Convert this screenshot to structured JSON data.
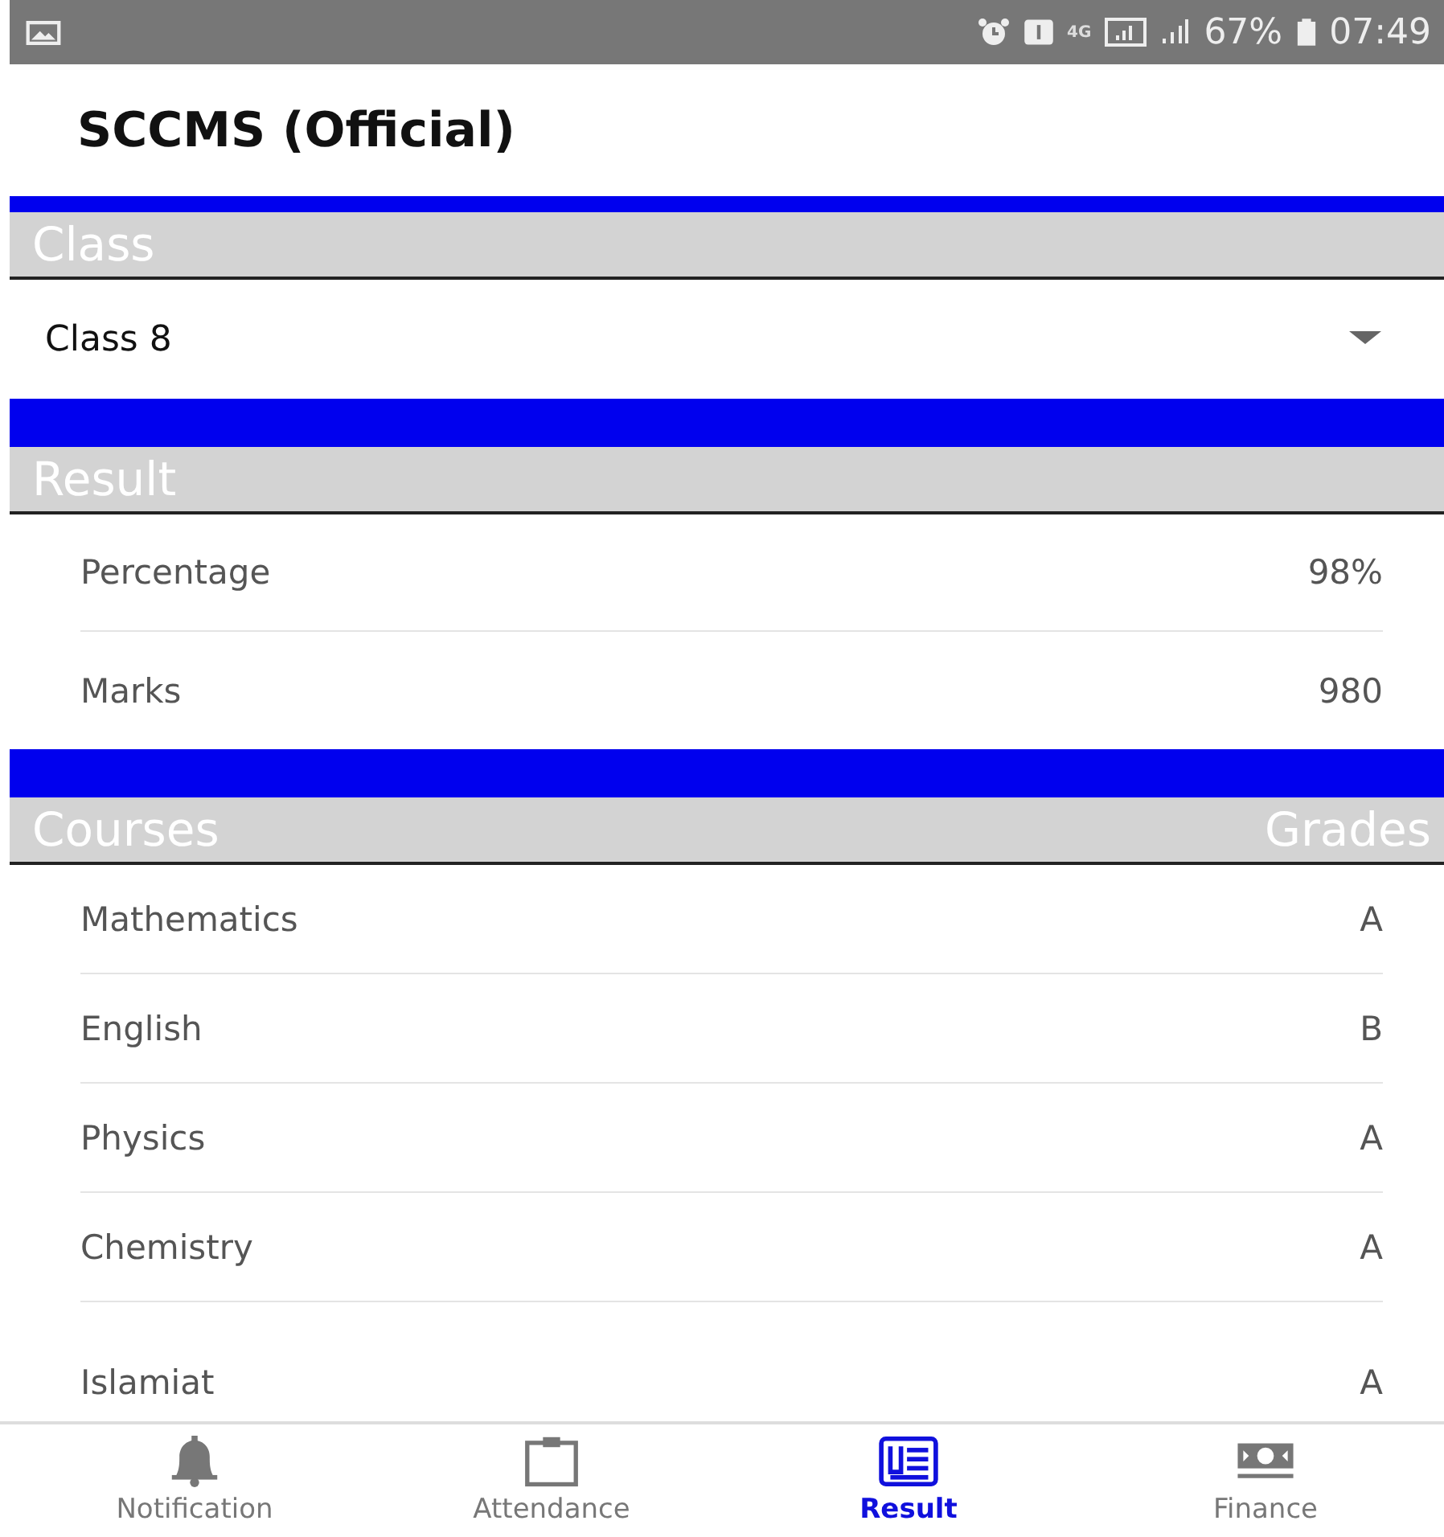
{
  "status_bar": {
    "network": "4G",
    "battery": "67%",
    "time": "07:49"
  },
  "app_title": "SCCMS (Official)",
  "class_section": {
    "header": "Class",
    "dropdown": {
      "value": "Class 8"
    }
  },
  "result_section": {
    "header": "Result",
    "rows": [
      {
        "label": "Percentage",
        "value": "98%"
      },
      {
        "label": "Marks",
        "value": "980"
      }
    ]
  },
  "courses_section": {
    "headers": [
      "Courses",
      "Grades"
    ],
    "rows": [
      {
        "course": "Mathematics",
        "grade": "A"
      },
      {
        "course": "English",
        "grade": "B"
      },
      {
        "course": "Physics",
        "grade": "A"
      },
      {
        "course": "Chemistry",
        "grade": "A"
      },
      {
        "course": "Islamiat",
        "grade": "A"
      }
    ]
  },
  "bottom_nav": [
    {
      "label": "Notification",
      "selected": false
    },
    {
      "label": "Attendance",
      "selected": false
    },
    {
      "label": "Result",
      "selected": true
    },
    {
      "label": "Finance",
      "selected": false
    }
  ]
}
